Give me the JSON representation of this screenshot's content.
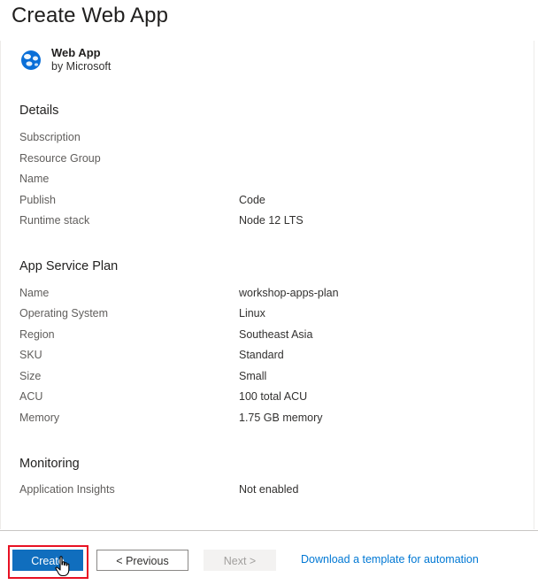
{
  "page": {
    "title": "Create Web App"
  },
  "product": {
    "name": "Web App",
    "publisher": "by Microsoft",
    "icon": "web-app-globe-icon"
  },
  "sections": {
    "details": {
      "title": "Details",
      "rows": [
        {
          "label": "Subscription",
          "value": ""
        },
        {
          "label": "Resource Group",
          "value": ""
        },
        {
          "label": "Name",
          "value": ""
        },
        {
          "label": "Publish",
          "value": "Code"
        },
        {
          "label": "Runtime stack",
          "value": "Node 12 LTS"
        }
      ]
    },
    "plan": {
      "title": "App Service Plan",
      "rows": [
        {
          "label": "Name",
          "value": "workshop-apps-plan"
        },
        {
          "label": "Operating System",
          "value": "Linux"
        },
        {
          "label": "Region",
          "value": "Southeast Asia"
        },
        {
          "label": "SKU",
          "value": "Standard"
        },
        {
          "label": "Size",
          "value": "Small"
        },
        {
          "label": "ACU",
          "value": "100 total ACU"
        },
        {
          "label": "Memory",
          "value": "1.75 GB memory"
        }
      ]
    },
    "monitoring": {
      "title": "Monitoring",
      "rows": [
        {
          "label": "Application Insights",
          "value": "Not enabled"
        }
      ]
    }
  },
  "footer": {
    "create_label": "Create",
    "previous_label": "< Previous",
    "next_label": "Next >",
    "download_link": "Download a template for automation"
  },
  "colors": {
    "primary": "#106ebe",
    "link": "#0078d4",
    "highlight": "#e81123"
  }
}
